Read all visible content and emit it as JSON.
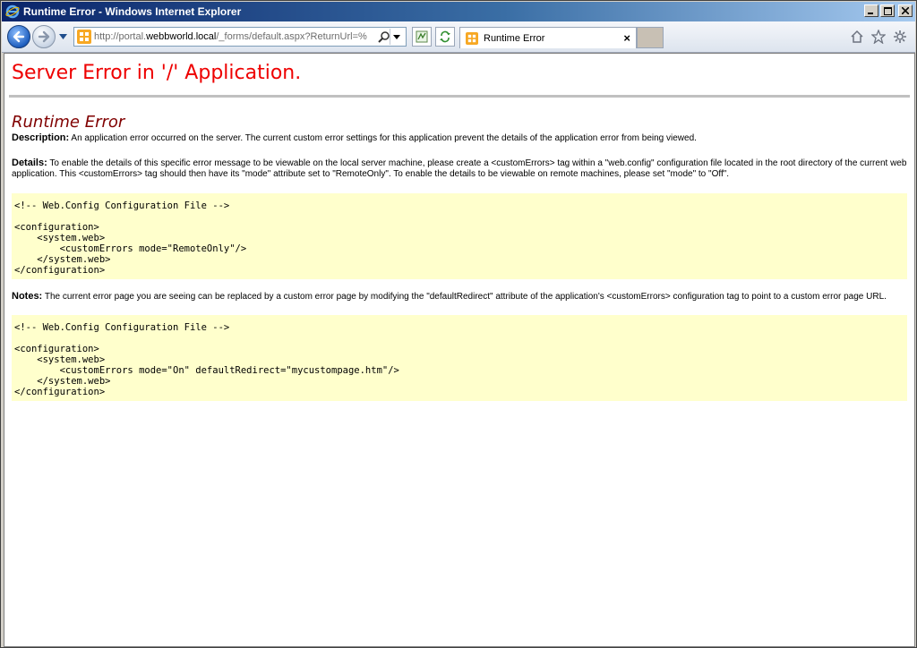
{
  "window": {
    "title": "Runtime Error - Windows Internet Explorer",
    "minimize": "_",
    "maximize": "□",
    "close": "X"
  },
  "address_bar": {
    "url_prefix": "http://portal.",
    "url_host": "webbworld.local",
    "url_suffix": "/_forms/default.aspx?ReturnUrl=%"
  },
  "tab": {
    "label": "Runtime Error",
    "close": "×"
  },
  "page": {
    "title": "Server Error in '/' Application.",
    "heading": "Runtime Error",
    "description_label": "Description:",
    "description_text": "An application error occurred on the server. The current custom error settings for this application prevent the details of the application error from being viewed.",
    "details_label": "Details:",
    "details_text": "To enable the details of this specific error message to be viewable on the local server machine, please create a <customErrors> tag within a \"web.config\" configuration file located in the root directory of the current web application. This <customErrors> tag should then have its \"mode\" attribute set to \"RemoteOnly\". To enable the details to be viewable on remote machines, please set \"mode\" to \"Off\".",
    "code1": "<!-- Web.Config Configuration File -->\n\n<configuration>\n    <system.web>\n        <customErrors mode=\"RemoteOnly\"/>\n    </system.web>\n</configuration>",
    "notes_label": "Notes:",
    "notes_text": "The current error page you are seeing can be replaced by a custom error page by modifying the \"defaultRedirect\" attribute of the application's <customErrors> configuration tag to point to a custom error page URL.",
    "code2": "<!-- Web.Config Configuration File -->\n\n<configuration>\n    <system.web>\n        <customErrors mode=\"On\" defaultRedirect=\"mycustompage.htm\"/>\n    </system.web>\n</configuration>"
  },
  "icons": {
    "app": "ie-logo-icon",
    "back": "back-arrow-icon",
    "forward": "forward-arrow-icon",
    "home": "home-icon",
    "favorites": "star-icon",
    "tools": "gear-icon"
  }
}
